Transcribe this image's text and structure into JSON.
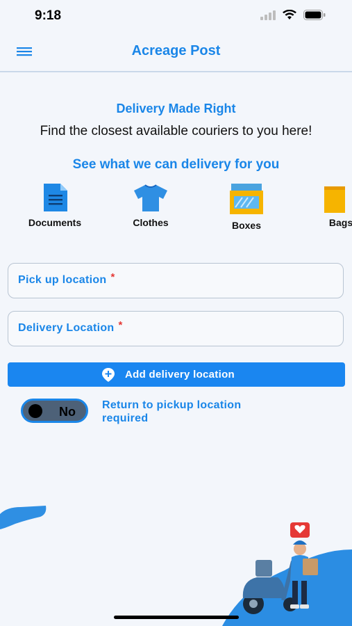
{
  "status_bar": {
    "time": "9:18",
    "icons": [
      "signal-icon",
      "wifi-icon",
      "battery-icon"
    ]
  },
  "app_bar": {
    "title": "Acreage Post",
    "menu_icon": "hamburger-menu-icon"
  },
  "hero": {
    "headline": "Delivery Made Right",
    "subheadline": "Find the closest available couriers to you here!"
  },
  "categories": {
    "title": "See what we can delivery for you",
    "items": [
      {
        "label": "Documents",
        "icon": "document-icon"
      },
      {
        "label": "Clothes",
        "icon": "tshirt-icon"
      },
      {
        "label": "Boxes",
        "icon": "box-icon"
      },
      {
        "label": "Bags",
        "icon": "bag-icon"
      }
    ]
  },
  "form": {
    "pickup_label": "Pick up location",
    "delivery_label": "Delivery Location",
    "required_marker": "*",
    "add_button_label": "Add delivery location",
    "toggle_value": "No",
    "return_label_line1": "Return to pickup location",
    "return_label_line2": "required"
  },
  "colors": {
    "accent": "#1a86e8",
    "button": "#1a86f0",
    "background": "#f3f6fb",
    "required": "#e53935"
  }
}
